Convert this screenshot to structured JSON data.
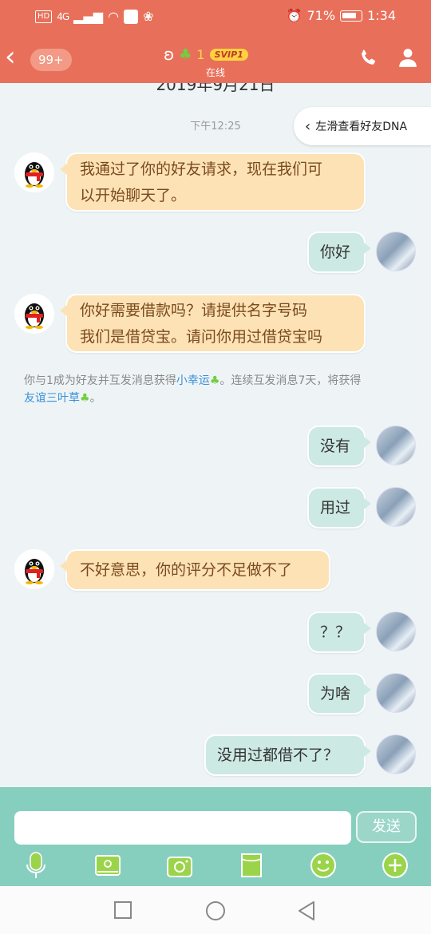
{
  "status_bar": {
    "left_badges": [
      "HD",
      "4G"
    ],
    "battery": "71%",
    "time": "1:34"
  },
  "header": {
    "unread_badge": "99+",
    "streak_count": "1",
    "vip_badge": "SVIP1",
    "status": "在线"
  },
  "chat": {
    "date_partial": "2019年9月21日",
    "dna_hint": "左滑查看好友DNA",
    "timestamp": "下午12:25",
    "messages": [
      {
        "side": "left",
        "line1": "我通过了你的好友请求，现在我们可",
        "line2": "以开始聊天了。"
      },
      {
        "side": "right",
        "text": "你好"
      },
      {
        "side": "left",
        "line1": "你好需要借款吗？请提供名字号码",
        "line2": "我们是借贷宝。请问你用过借贷宝吗"
      },
      {
        "side": "right",
        "text": "没有"
      },
      {
        "side": "right",
        "text": "用过"
      },
      {
        "side": "left",
        "text": "不好意思，你的评分不足做不了"
      },
      {
        "side": "right",
        "text": "？？"
      },
      {
        "side": "right",
        "text": "为啥"
      },
      {
        "side": "right",
        "text": "没用过都借不了？"
      }
    ],
    "system_note": {
      "part1": "你与1成为好友并互发消息获得",
      "link1": "小幸运",
      "part2": "。连续互发消息7天，将获得",
      "link2": "友谊三叶草",
      "part3": "。"
    }
  },
  "input": {
    "placeholder": "",
    "send_label": "发送"
  },
  "colors": {
    "header_bg": "#e8705a",
    "left_bubble": "#fde2b6",
    "right_bubble": "#cde9e3",
    "input_bar": "#86cfbf"
  },
  "icons": [
    "back-icon",
    "ear-icon",
    "sprout-icon",
    "phone-icon",
    "profile-icon",
    "microphone-icon",
    "image-icon",
    "camera-icon",
    "file-icon",
    "emoji-icon",
    "plus-icon",
    "square-icon",
    "circle-icon",
    "triangle-icon"
  ]
}
